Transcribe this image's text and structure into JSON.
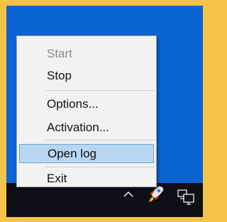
{
  "context_menu": {
    "items": [
      {
        "label": "Start",
        "state": "disabled"
      },
      {
        "label": "Stop",
        "state": "normal"
      },
      {
        "label": "Options...",
        "state": "normal"
      },
      {
        "label": "Activation...",
        "state": "normal"
      },
      {
        "label": "Open log",
        "state": "highlighted"
      },
      {
        "label": "Exit",
        "state": "normal"
      }
    ]
  },
  "tray": {
    "icons": [
      "chevron-up-icon",
      "rocket-icon",
      "monitor-network-icon"
    ]
  },
  "colors": {
    "desktop": "#0a64d2",
    "taskbar": "#0e0f17",
    "frame": "#f5c24a",
    "menu_background": "#f2f2f2",
    "highlight": "#b7d7f2"
  }
}
